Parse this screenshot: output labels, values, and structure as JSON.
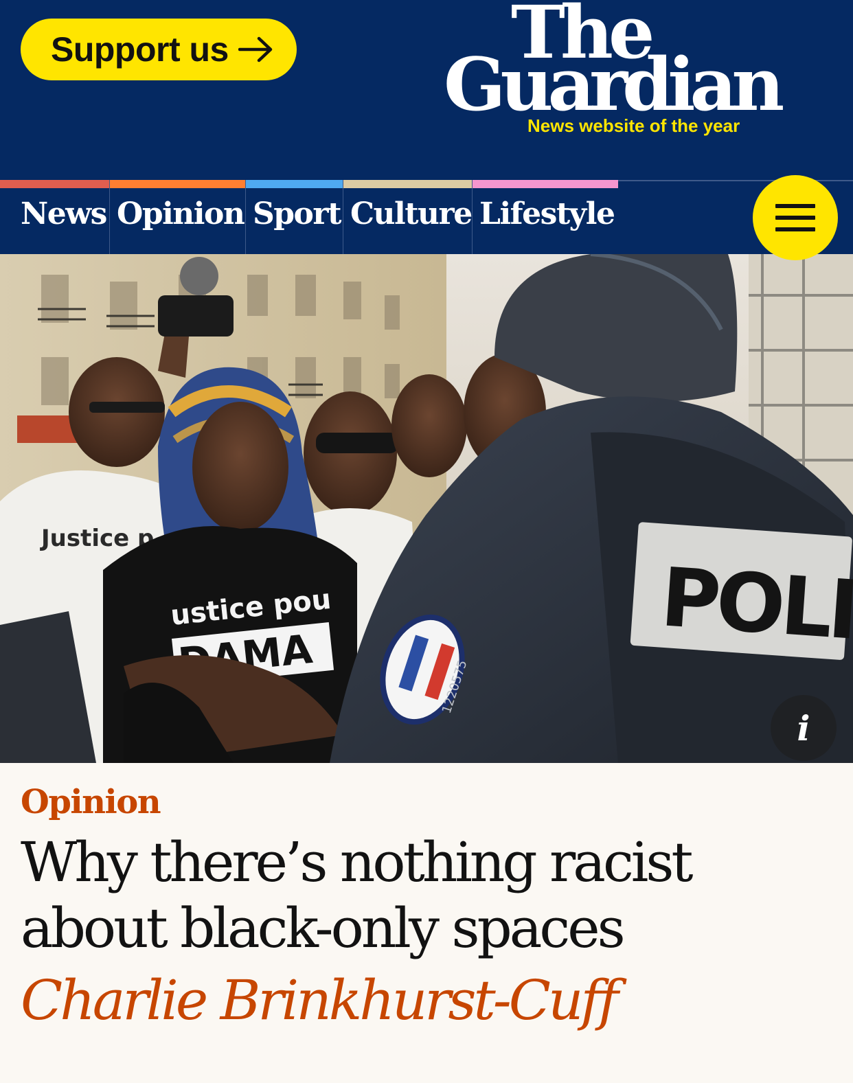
{
  "header": {
    "support_label": "Support us",
    "logo_line1": "The",
    "logo_line2": "Guardian",
    "tagline": "News website of the year"
  },
  "nav": {
    "items": [
      {
        "label": "News",
        "color": "#e05e4f"
      },
      {
        "label": "Opinion",
        "color": "#ff7f31"
      },
      {
        "label": "Sport",
        "color": "#4fa9f0"
      },
      {
        "label": "Culture",
        "color": "#dccba3"
      },
      {
        "label": "Lifestyle",
        "color": "#f596cf"
      }
    ],
    "menu_icon": "hamburger-icon"
  },
  "hero": {
    "shirt_text_1": "Justice p",
    "shirt_text_2": "ustice pou",
    "shirt_text_3": "DAMA",
    "vest_text": "POLICE",
    "badge_number": "1220575",
    "info_label": "i"
  },
  "article": {
    "kicker": "Opinion",
    "headline": "Why there’s nothing racist about black-only spaces",
    "byline": "Charlie Brinkhurst-Cuff"
  },
  "colors": {
    "brand_blue": "#052962",
    "support_yellow": "#ffe500",
    "opinion_orange": "#c74600",
    "background": "#fbf8f3"
  }
}
